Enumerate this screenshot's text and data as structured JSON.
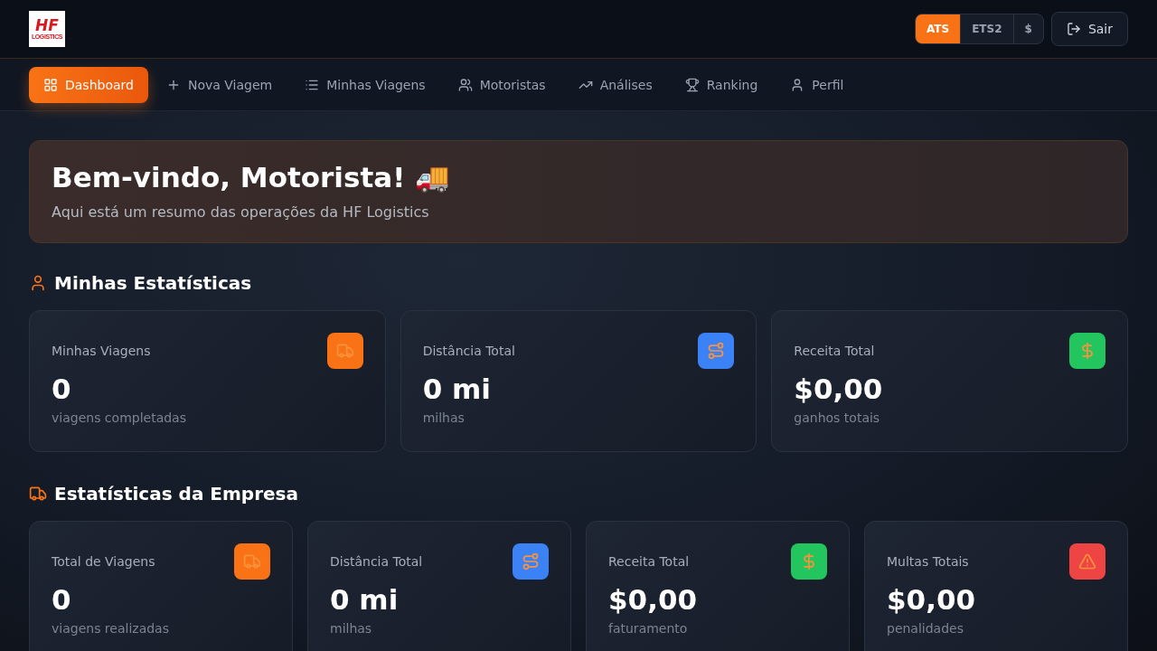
{
  "logo": {
    "mark": "HF",
    "subtitle": "LOGISTICS"
  },
  "game_selector": [
    {
      "label": "ATS",
      "selected": true
    },
    {
      "label": "ETS2",
      "selected": false
    },
    {
      "label": "$",
      "selected": false
    }
  ],
  "logout_button": "Sair",
  "nav": [
    {
      "label": "Dashboard",
      "kind": "dashboard",
      "selected": true
    },
    {
      "label": "Nova Viagem",
      "kind": "plus",
      "selected": false
    },
    {
      "label": "Minhas Viagens",
      "kind": "list",
      "selected": false
    },
    {
      "label": "Motoristas",
      "kind": "users",
      "selected": false
    },
    {
      "label": "Análises",
      "kind": "trend",
      "selected": false
    },
    {
      "label": "Ranking",
      "kind": "trophy",
      "selected": false
    },
    {
      "label": "Perfil",
      "kind": "user",
      "selected": false
    }
  ],
  "welcome": {
    "title": "Bem-vindo, Motorista! 🚚",
    "subtitle": "Aqui está um resumo das operações da HF Logistics"
  },
  "sections": [
    {
      "title": "Minhas Estatísticas",
      "kind": "user",
      "cards": [
        {
          "label": "Minhas Viagens",
          "value": "0",
          "caption": "viagens completadas",
          "kind": "truck",
          "color": "#f97316"
        },
        {
          "label": "Distância Total",
          "value": "0 mi",
          "caption": "milhas",
          "kind": "route",
          "color": "#3b82f6"
        },
        {
          "label": "Receita Total",
          "value": "$0,00",
          "caption": "ganhos totais",
          "kind": "dollar",
          "color": "#22c55e"
        }
      ]
    },
    {
      "title": "Estatísticas da Empresa",
      "kind": "truck",
      "cards": [
        {
          "label": "Total de Viagens",
          "value": "0",
          "caption": "viagens realizadas",
          "kind": "truck",
          "color": "#f97316"
        },
        {
          "label": "Distância Total",
          "value": "0 mi",
          "caption": "milhas",
          "kind": "route",
          "color": "#3b82f6"
        },
        {
          "label": "Receita Total",
          "value": "$0,00",
          "caption": "faturamento",
          "kind": "dollar",
          "color": "#22c55e"
        },
        {
          "label": "Multas Totais",
          "value": "$0,00",
          "caption": "penalidades",
          "kind": "alert",
          "color": "#ef4444"
        }
      ]
    }
  ]
}
